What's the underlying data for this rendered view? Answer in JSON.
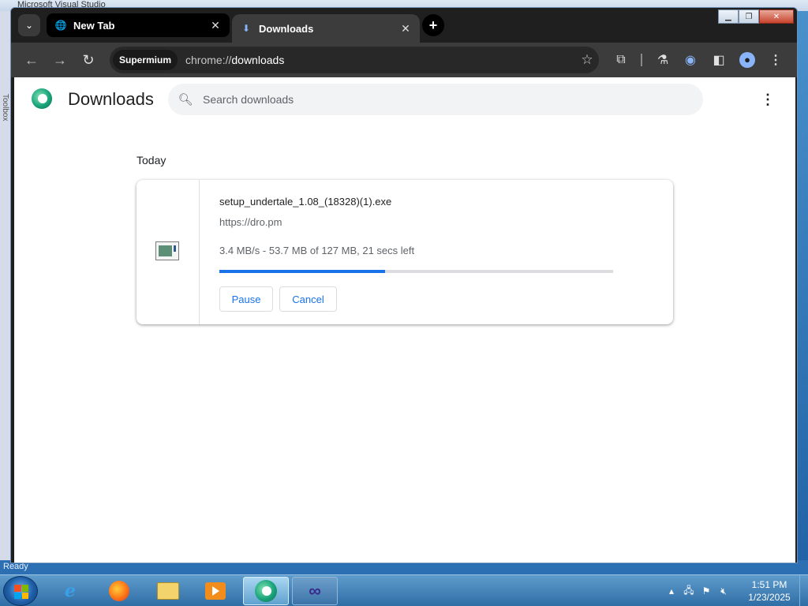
{
  "background_app": {
    "title": "Microsoft Visual Studio",
    "side_label": "Toolbox",
    "status": "Ready"
  },
  "window": {
    "controls": {
      "minimize": "▁",
      "restore": "❐",
      "close": "✕"
    }
  },
  "tabs": [
    {
      "label": "New Tab",
      "icon": "globe-icon",
      "active": false
    },
    {
      "label": "Downloads",
      "icon": "download-icon",
      "active": true
    }
  ],
  "toolbar": {
    "chip": "Supermium",
    "url_prefix": "chrome://",
    "url_host": "downloads"
  },
  "page": {
    "title": "Downloads",
    "search_placeholder": "Search downloads",
    "section_date": "Today",
    "download": {
      "file_name": "setup_undertale_1.08_(18328)(1).exe",
      "source_url": "https://dro.pm",
      "status": "3.4 MB/s - 53.7 MB of 127 MB, 21 secs left",
      "progress_fraction": 0.42,
      "pause_label": "Pause",
      "cancel_label": "Cancel"
    }
  },
  "taskbar": {
    "apps": [
      "start-button",
      "internet-explorer",
      "firefox",
      "file-explorer",
      "media-player",
      "supermium",
      "visual-studio"
    ],
    "clock_time": "1:51 PM",
    "clock_date": "1/23/2025"
  },
  "colors": {
    "accent": "#1a73e8",
    "tab_strip": "#1f1f1f",
    "toolbar": "#3c3c3c"
  }
}
